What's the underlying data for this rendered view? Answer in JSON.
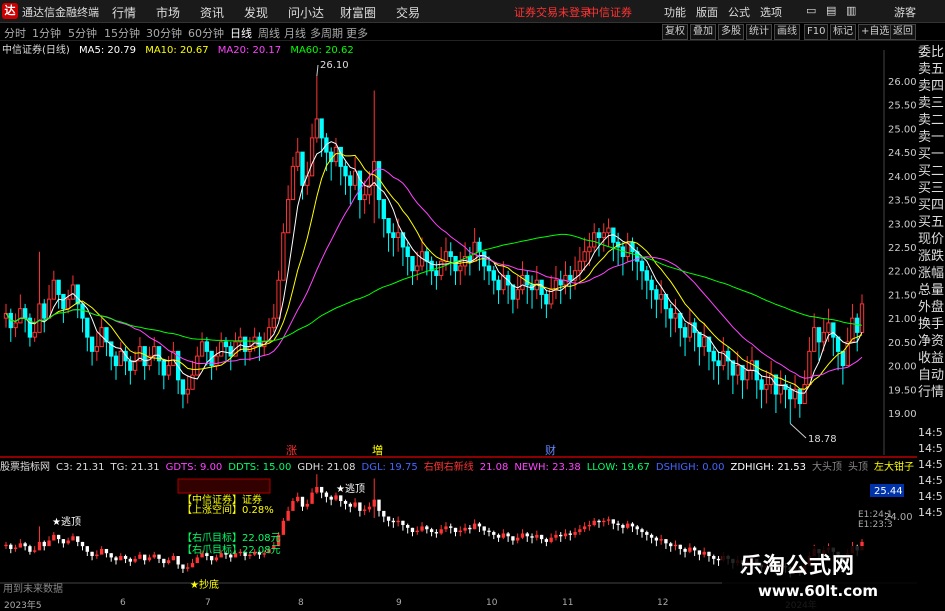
{
  "app": {
    "title": "通达信金融终端",
    "menu": [
      "行情",
      "市场",
      "资讯",
      "发现",
      "问小达",
      "财富圈",
      "交易"
    ],
    "broker_login": "证券交易未登录",
    "broker_name": "中信证券",
    "right_menu": [
      "功能",
      "版面",
      "公式",
      "选项"
    ],
    "guest": "游客"
  },
  "period_bar": {
    "periods": [
      "分时",
      "1分钟",
      "5分钟",
      "15分钟",
      "30分钟",
      "60分钟",
      "日线",
      "周线",
      "月线",
      "多周期",
      "更多"
    ],
    "active": "日线",
    "buttons": [
      "复权",
      "叠加",
      "多股",
      "统计",
      "画线",
      "F10",
      "标记",
      "+自选",
      "返回"
    ]
  },
  "stock": {
    "name": "中信证券(日线)",
    "ma_legend": [
      {
        "label": "MA5: 20.79",
        "color": "#ffffff"
      },
      {
        "label": "MA10: 20.67",
        "color": "#ffff00"
      },
      {
        "label": "MA20: 20.17",
        "color": "#ff44ff"
      },
      {
        "label": "MA60: 20.62",
        "color": "#00ff00"
      }
    ]
  },
  "price_axis": [
    "26.00",
    "25.50",
    "25.00",
    "24.50",
    "24.00",
    "23.50",
    "23.00",
    "22.50",
    "22.00",
    "21.50",
    "21.00",
    "20.50",
    "20.00",
    "19.50",
    "19.00"
  ],
  "right_panel": {
    "items": [
      "委比",
      "卖五",
      "卖四",
      "卖三",
      "卖二",
      "卖一",
      "买一",
      "买二",
      "买三",
      "买四",
      "买五",
      "现价",
      "涨跌",
      "涨幅",
      "总量",
      "外盘",
      "换手",
      "净资",
      "收益",
      "自动",
      "行情"
    ],
    "times": [
      "14:5",
      "14:5",
      "14:5",
      "14:5",
      "14:5",
      "14:5"
    ]
  },
  "event_markers": [
    {
      "label": "涨",
      "color": "#ff3333"
    },
    {
      "label": "増",
      "color": "#ffff00"
    },
    {
      "label": "财",
      "color": "#6688ff"
    }
  ],
  "annotations": {
    "high": "26.10",
    "low": "18.78",
    "escape_top_1": "★逃顶",
    "escape_top_2": "★逃顶",
    "bottom_buy": "★抄底",
    "future_note": "用到未来数据"
  },
  "indicator_bar": [
    {
      "label": "股票指标网",
      "color": "#dddddd"
    },
    {
      "label": "C3: 21.31",
      "color": "#dddddd"
    },
    {
      "label": "TG: 21.31",
      "color": "#dddddd"
    },
    {
      "label": "GDTS: 9.00",
      "color": "#ff44ff"
    },
    {
      "label": "DDTS: 15.00",
      "color": "#00ff66"
    },
    {
      "label": "GDH: 21.08",
      "color": "#dddddd"
    },
    {
      "label": "DGL: 19.75",
      "color": "#4466ff"
    },
    {
      "label": "右倒右新线",
      "color": "#ff3333"
    },
    {
      "label": "21.08",
      "color": "#ff44ff"
    },
    {
      "label": "NEWH: 23.38",
      "color": "#ff44ff"
    },
    {
      "label": "LLOW: 19.67",
      "color": "#00ff66"
    },
    {
      "label": "DSHIGH: 0.00",
      "color": "#4466ff"
    },
    {
      "label": "ZDHIGH: 21.53",
      "color": "#ffffff"
    },
    {
      "label": "大头顶",
      "color": "#888888"
    },
    {
      "label": "头顶",
      "color": "#888888"
    },
    {
      "label": "左大钳子",
      "color": "#ffff00"
    }
  ],
  "info_box": [
    {
      "label": "【中信证券】证券",
      "color": "#ffff00"
    },
    {
      "label": "【上涨空间】0.28%",
      "color": "#ffff00"
    },
    {
      "label": "【右爪目标】22.08元",
      "color": "#00ff66"
    },
    {
      "label": "【右爪目标】22.08元",
      "color": "#00ff66"
    }
  ],
  "sub_axis": {
    "value": "25.44",
    "level": "24.00",
    "times": [
      "E1:24:1",
      "E1:23:3"
    ]
  },
  "dates": [
    "2023年5",
    "6",
    "7",
    "8",
    "9",
    "10",
    "11",
    "12",
    "2024年"
  ],
  "watermark": {
    "title": "乐淘公式网",
    "url": "www.60lt.com"
  },
  "chart_data": {
    "type": "candlestick",
    "title": "中信证券(日线)",
    "ylim": [
      18.6,
      26.4
    ],
    "colors": {
      "up": "#ff3333",
      "down": "#00ffff",
      "ma5": "#ffffff",
      "ma10": "#ffff00",
      "ma20": "#ff44ff",
      "ma60": "#00ff00"
    },
    "closes": [
      21.1,
      20.8,
      20.9,
      21.2,
      21.0,
      20.6,
      20.7,
      21.3,
      21.0,
      21.4,
      21.8,
      21.5,
      21.2,
      21.4,
      21.7,
      21.3,
      21.0,
      20.6,
      20.3,
      20.4,
      20.8,
      20.5,
      20.2,
      20.0,
      20.3,
      20.1,
      19.9,
      20.1,
      20.4,
      20.0,
      20.2,
      20.4,
      20.1,
      19.8,
      20.0,
      20.3,
      19.7,
      19.4,
      19.5,
      19.8,
      20.2,
      20.5,
      20.3,
      20.0,
      20.2,
      20.5,
      20.4,
      20.2,
      20.5,
      20.6,
      20.3,
      20.4,
      20.6,
      20.4,
      20.5,
      20.8,
      21.0,
      21.8,
      22.8,
      23.5,
      24.2,
      24.5,
      23.8,
      24.0,
      24.8,
      25.2,
      24.8,
      24.5,
      24.3,
      24.6,
      24.2,
      24.0,
      23.8,
      24.1,
      23.5,
      23.6,
      23.8,
      24.3,
      23.5,
      23.1,
      22.8,
      22.7,
      22.8,
      22.5,
      22.3,
      22.0,
      22.1,
      22.4,
      22.2,
      22.0,
      21.9,
      22.2,
      22.4,
      22.3,
      22.0,
      22.1,
      22.3,
      22.2,
      22.6,
      22.4,
      22.1,
      22.0,
      21.8,
      21.6,
      21.9,
      21.7,
      21.4,
      21.6,
      21.9,
      21.7,
      21.6,
      21.8,
      21.5,
      21.3,
      21.6,
      21.8,
      21.7,
      21.9,
      21.8,
      22.0,
      22.2,
      22.4,
      22.5,
      22.8,
      22.7,
      22.8,
      22.9,
      22.6,
      22.5,
      22.3,
      22.6,
      22.4,
      22.2,
      22.0,
      21.8,
      21.6,
      21.4,
      21.5,
      21.2,
      21.0,
      21.1,
      20.8,
      20.6,
      20.9,
      20.7,
      20.4,
      20.6,
      20.3,
      20.1,
      20.0,
      20.3,
      20.1,
      19.8,
      20.0,
      19.7,
      19.9,
      20.1,
      19.7,
      19.5,
      19.6,
      19.8,
      19.4,
      19.6,
      19.5,
      19.3,
      19.5,
      19.2,
      19.6,
      20.3,
      20.8,
      20.5,
      20.7,
      20.9,
      20.6,
      20.3,
      20.0,
      20.5,
      21.0,
      20.7,
      21.3
    ],
    "highs": [
      21.3,
      21.2,
      21.1,
      21.5,
      21.3,
      21.1,
      21.0,
      22.4,
      21.4,
      21.7,
      22.0,
      21.8,
      21.5,
      21.6,
      21.9,
      21.6,
      21.3,
      21.0,
      20.6,
      20.7,
      21.0,
      20.8,
      20.5,
      20.3,
      20.5,
      20.4,
      20.2,
      20.3,
      20.6,
      20.3,
      20.4,
      20.6,
      20.4,
      20.1,
      20.2,
      20.5,
      20.0,
      19.7,
      19.8,
      20.1,
      20.4,
      20.7,
      20.6,
      20.3,
      20.4,
      20.7,
      20.6,
      20.5,
      20.7,
      20.8,
      20.6,
      20.6,
      20.8,
      20.7,
      20.7,
      21.0,
      21.3,
      22.0,
      23.0,
      23.8,
      24.4,
      24.8,
      24.3,
      24.3,
      25.1,
      26.1,
      25.1,
      24.9,
      24.6,
      24.8,
      24.6,
      24.3,
      24.1,
      24.4,
      23.9,
      23.9,
      24.1,
      25.8,
      23.9,
      23.4,
      23.1,
      23.0,
      23.1,
      22.8,
      22.6,
      22.3,
      22.4,
      22.7,
      22.5,
      22.3,
      22.2,
      22.5,
      22.7,
      22.6,
      22.3,
      22.4,
      22.6,
      22.5,
      22.9,
      22.7,
      22.4,
      22.3,
      22.1,
      21.9,
      22.2,
      22.0,
      21.7,
      21.9,
      22.2,
      22.0,
      21.9,
      22.1,
      21.8,
      21.6,
      21.9,
      22.1,
      22.0,
      22.2,
      22.1,
      22.3,
      22.5,
      22.7,
      22.8,
      23.0,
      22.9,
      23.0,
      23.1,
      22.9,
      22.8,
      22.6,
      22.8,
      22.7,
      22.5,
      22.3,
      22.1,
      21.9,
      21.7,
      21.8,
      21.5,
      21.3,
      21.4,
      21.1,
      20.9,
      21.2,
      21.0,
      20.7,
      20.9,
      20.6,
      20.4,
      20.3,
      20.6,
      20.4,
      20.1,
      20.3,
      20.0,
      20.2,
      20.4,
      20.0,
      19.8,
      19.9,
      20.1,
      19.7,
      19.9,
      19.8,
      19.6,
      19.8,
      19.5,
      19.9,
      20.6,
      21.1,
      20.8,
      21.0,
      21.2,
      20.9,
      20.6,
      20.3,
      20.8,
      21.3,
      21.1,
      21.5
    ],
    "lows": [
      20.8,
      20.5,
      20.6,
      20.9,
      20.7,
      20.4,
      20.5,
      20.8,
      20.7,
      21.1,
      21.4,
      21.2,
      20.9,
      21.1,
      21.4,
      21.0,
      20.7,
      20.3,
      20.0,
      20.1,
      20.5,
      20.2,
      19.9,
      19.7,
      20.0,
      19.8,
      19.6,
      19.8,
      20.1,
      19.7,
      19.9,
      20.1,
      19.8,
      19.5,
      19.7,
      20.0,
      19.4,
      19.1,
      19.2,
      19.5,
      19.9,
      20.2,
      20.0,
      19.7,
      19.9,
      20.2,
      20.1,
      19.9,
      20.2,
      20.3,
      20.0,
      20.1,
      20.3,
      20.1,
      20.2,
      20.5,
      20.7,
      21.4,
      22.4,
      23.1,
      23.8,
      24.1,
      23.5,
      23.6,
      24.4,
      24.7,
      24.4,
      24.1,
      23.9,
      24.2,
      23.8,
      23.6,
      23.4,
      23.7,
      23.1,
      23.2,
      23.4,
      23.0,
      23.1,
      22.7,
      22.4,
      22.3,
      22.4,
      22.1,
      21.9,
      21.7,
      21.8,
      22.0,
      21.9,
      21.7,
      21.6,
      21.8,
      22.0,
      21.9,
      21.7,
      21.7,
      21.9,
      21.9,
      22.2,
      22.0,
      21.8,
      21.7,
      21.5,
      21.3,
      21.5,
      21.3,
      21.1,
      21.2,
      21.5,
      21.3,
      21.2,
      21.4,
      21.2,
      21.0,
      21.2,
      21.4,
      21.3,
      21.5,
      21.4,
      21.6,
      21.8,
      22.0,
      22.1,
      22.4,
      22.3,
      22.4,
      22.5,
      22.2,
      22.1,
      21.9,
      22.2,
      22.0,
      21.8,
      21.6,
      21.4,
      21.2,
      21.0,
      21.1,
      20.8,
      20.6,
      20.7,
      20.4,
      20.2,
      20.5,
      20.3,
      20.0,
      20.2,
      19.9,
      19.7,
      19.6,
      19.9,
      19.7,
      19.4,
      19.6,
      19.3,
      19.5,
      19.7,
      19.3,
      19.1,
      19.2,
      19.4,
      19.0,
      19.2,
      19.1,
      18.78,
      19.1,
      18.9,
      19.2,
      19.9,
      20.4,
      20.1,
      20.3,
      20.5,
      20.2,
      19.9,
      19.6,
      20.1,
      20.6,
      20.3,
      20.9
    ]
  }
}
